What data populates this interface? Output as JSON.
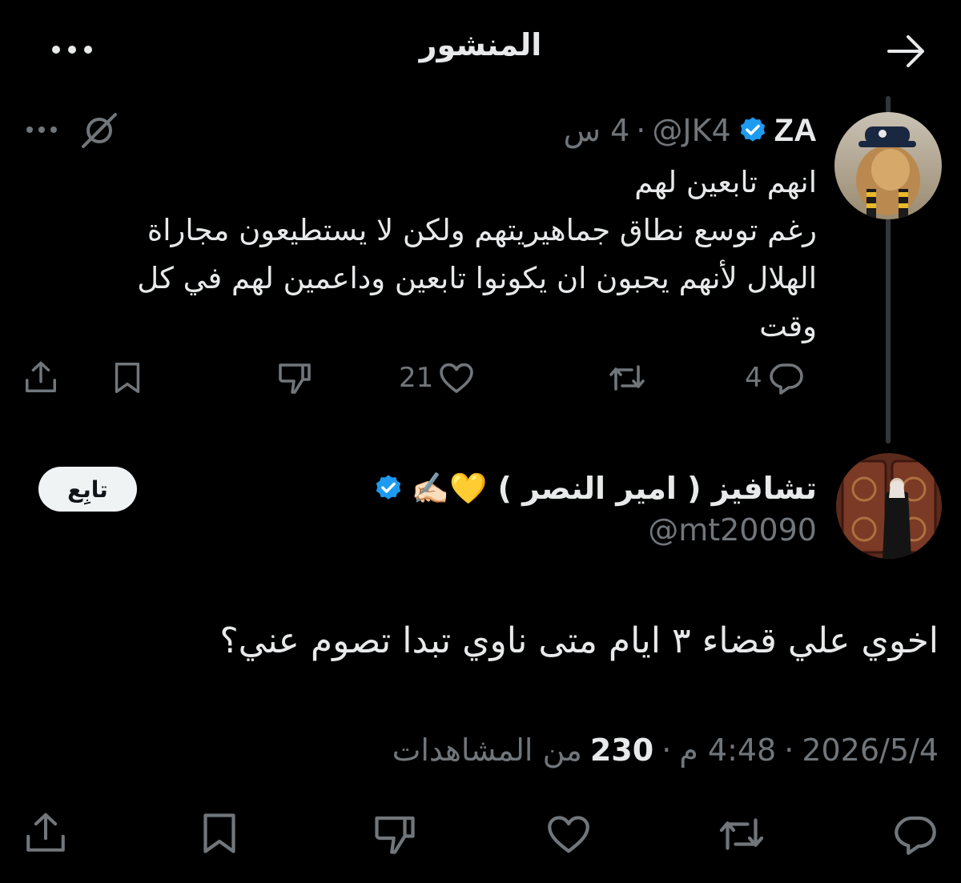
{
  "header": {
    "title": "المنشور",
    "back_icon": "arrow-right-icon",
    "more_icon": "more-horizontal-icon"
  },
  "parent_tweet": {
    "name": "ZA",
    "handle": "@JK4",
    "separator": "·",
    "time": "4 س",
    "verified": true,
    "text_lines": [
      "انهم تابعين لهم",
      "رغم توسع نطاق جماهيريتهم ولكن لا يستطيعون مجاراة",
      "الهلال لأنهم يحبون ان يكونوا تابعين وداعمين لهم في كل",
      "وقت"
    ],
    "actions": {
      "reply_count": "4",
      "like_count": "21"
    }
  },
  "reply": {
    "name": "تشافيز ( امير النصر ) 💛✍🏻",
    "handle": "@mt20090",
    "follow_label": "تابِع",
    "text": "اخوي علي قضاء ٣ ايام متى ناوي تبدا تصوم عني؟",
    "date": "2026/5/4",
    "time": "4:48 م",
    "separator": "·",
    "views_count": "230",
    "views_label": "من المشاهدات"
  },
  "colors": {
    "background": "#000000",
    "text": "#e7e9ea",
    "secondary": "#71767b",
    "verified": "#1d9bf0",
    "follow_bg": "#eff3f4"
  }
}
